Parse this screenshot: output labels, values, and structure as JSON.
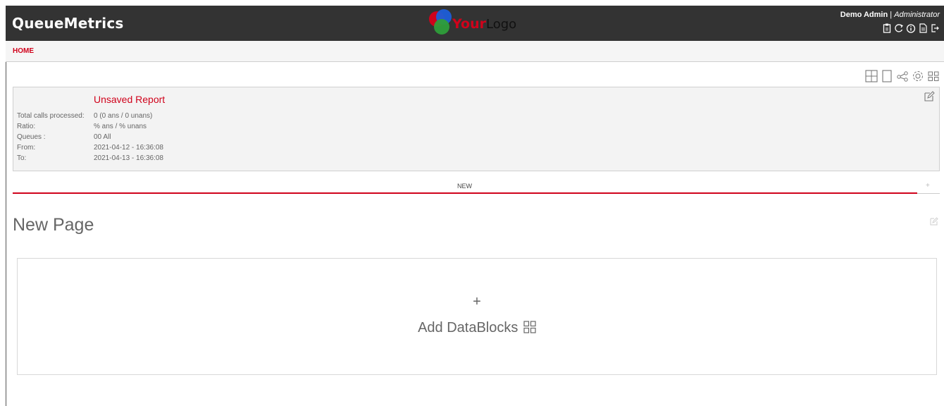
{
  "app": {
    "brand": "QueueMetrics",
    "logo_text": {
      "part1": "Your",
      "part2": "Logo"
    },
    "user_name": "Demo Admin",
    "separator": " | ",
    "user_role": "Administrator",
    "top_icons": [
      "clipboard-icon",
      "refresh-icon",
      "info-icon",
      "document-icon",
      "logout-icon"
    ]
  },
  "breadcrumb": {
    "home": "HOME"
  },
  "toolbar": {
    "icons": [
      "add-grid-icon",
      "page-icon",
      "share-icon",
      "settings-icon",
      "blocks-icon"
    ]
  },
  "report": {
    "title": "Unsaved Report",
    "rows": [
      {
        "label": "Total calls processed:",
        "value": "0 (0 ans / 0 unans)"
      },
      {
        "label": "Ratio:",
        "value": "% ans / % unans"
      },
      {
        "label": "Queues :",
        "value": "00 All"
      },
      {
        "label": "From:",
        "value": "2021-04-12 - 16:36:08"
      },
      {
        "label": "To:",
        "value": "2021-04-13 - 16:36:08"
      }
    ]
  },
  "tabs": {
    "active": "NEW",
    "add": "+"
  },
  "page": {
    "title": "New Page"
  },
  "datablocks": {
    "plus": "+",
    "label": "Add DataBlocks"
  },
  "colors": {
    "topbar": "#333333",
    "accent": "#d0021b"
  }
}
